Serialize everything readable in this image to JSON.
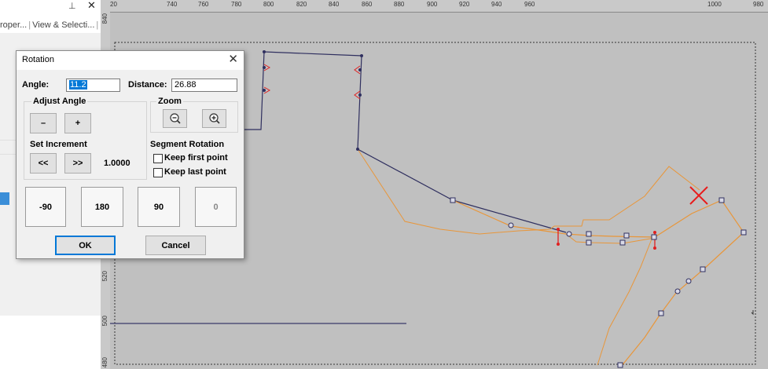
{
  "panel": {
    "pin_icon": "pin-icon",
    "close_glyph": "✕",
    "tabs": [
      "roper...",
      "View & Selecti..."
    ]
  },
  "ruler": {
    "top_ticks": [
      "20",
      "740",
      "760",
      "780",
      "800",
      "820",
      "840",
      "860",
      "880",
      "900",
      "920",
      "940",
      "960",
      "980",
      "1000"
    ],
    "left_ticks": [
      "840",
      "520",
      "500",
      "480"
    ]
  },
  "dialog": {
    "title": "Rotation",
    "close_glyph": "✕",
    "angle_label": "Angle:",
    "angle_value": "11.2",
    "distance_label": "Distance:",
    "distance_value": "26.88",
    "adjust_angle_label": "Adjust Angle",
    "minus_label": "–",
    "plus_label": "+",
    "set_increment_label": "Set Increment",
    "decrease_label": "<<",
    "increase_label": ">>",
    "increment_value": "1.0000",
    "zoom_label": "Zoom",
    "zoom_out_icon": "zoom-out-icon",
    "zoom_in_icon": "zoom-in-icon",
    "segment_rotation_label": "Segment Rotation",
    "keep_first_label": "Keep first point",
    "keep_first_checked": false,
    "keep_last_label": "Keep last point",
    "keep_last_checked": false,
    "preset_buttons": [
      "-90",
      "180",
      "90",
      "0"
    ],
    "ok_label": "OK",
    "cancel_label": "Cancel"
  },
  "colors": {
    "canvas_bg": "#c0c0c0",
    "shape_line": "#2f2f5f",
    "preview_line": "#e8963a",
    "marker_red": "#e02020",
    "accent": "#0078d7"
  }
}
